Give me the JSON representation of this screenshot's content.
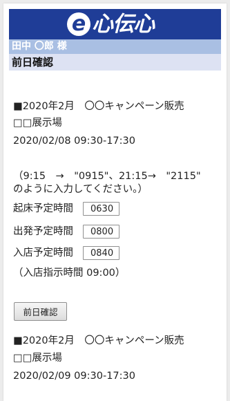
{
  "logo": {
    "mark": "e",
    "text": "心伝心"
  },
  "user_bar": {
    "name": "田中 〇郎 様"
  },
  "section": {
    "title": "前日確認"
  },
  "events": [
    {
      "title": "■2020年2月　〇〇キャンペーン販売",
      "venue": "□□展示場",
      "datetime": "2020/02/08 09:30-17:30"
    },
    {
      "title": "■2020年2月　〇〇キャンペーン販売",
      "venue": "□□展示場",
      "datetime": "2020/02/09 09:30-17:30"
    }
  ],
  "instructions": {
    "line1": "（9:15　→　\"0915\"、21:15→　\"2115\"",
    "line2": "のように入力してください。）"
  },
  "form": {
    "wake_label": "起床予定時間",
    "wake_value": "0630",
    "depart_label": "出発予定時間",
    "depart_value": "0800",
    "arrive_label": "入店予定時間",
    "arrive_value": "0840",
    "instruction_time": "（入店指示時間 09:00）"
  },
  "buttons": {
    "confirm_label": "前日確認"
  },
  "colors": {
    "banner": "#1f3d97",
    "user_bar": "#a9bfe3",
    "section_bar": "#dde2f3"
  }
}
